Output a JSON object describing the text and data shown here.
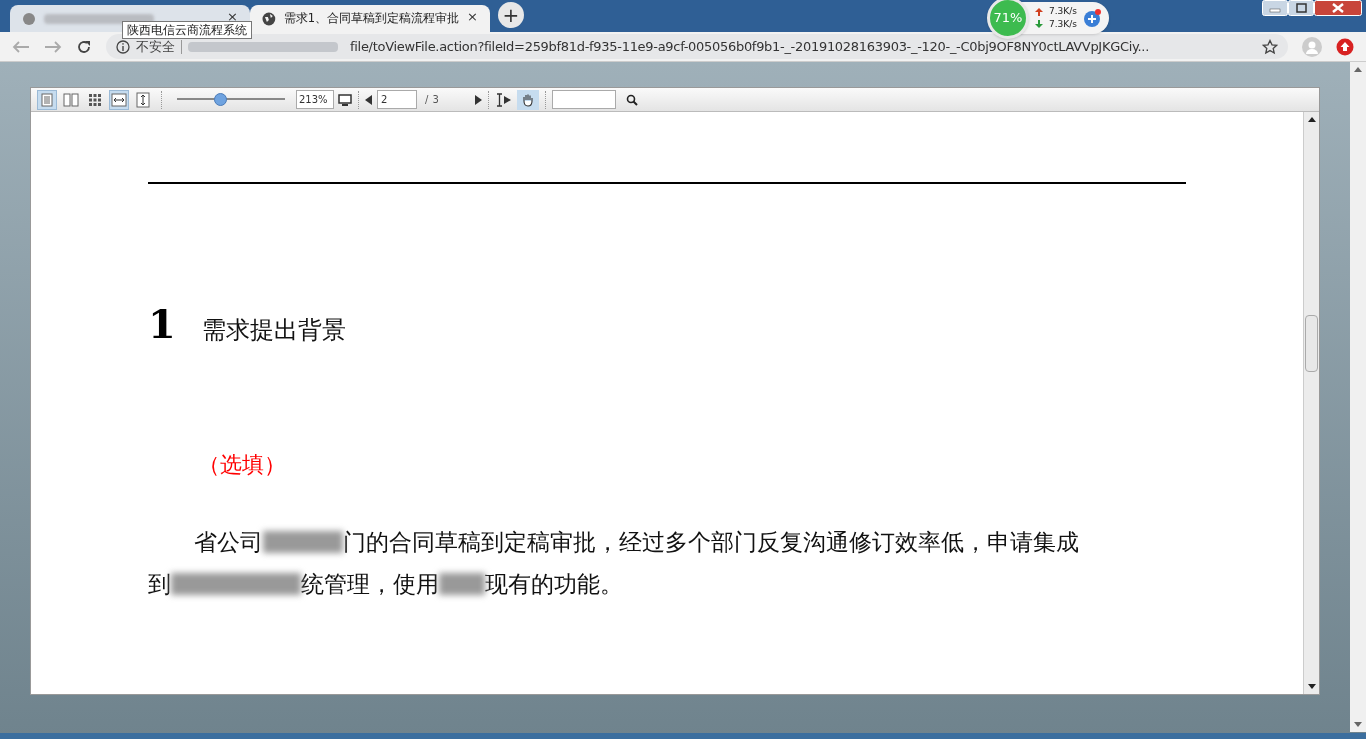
{
  "tabs": [
    {
      "kind": "redacted",
      "selected": false,
      "close": "×"
    },
    {
      "kind": "titled",
      "title": "需求1、合同草稿到定稿流程审批",
      "selected": true,
      "close": "×"
    }
  ],
  "new_tab": "+",
  "tooltip": "陕西电信云商流程系统",
  "address": {
    "security": "不安全",
    "url": "file/toViewFile.action?fileId=259bf81d-f935-11e9-a9cf-005056b0f9b1-_-20191028163903-_-120-_-C0bj9OF8NY0ctLAVVpJKGCiy..."
  },
  "speed_widget": {
    "percent": "71%",
    "up": "7.3K/s",
    "down": "7.3K/s"
  },
  "viewer": {
    "zoom": {
      "level": 0.4,
      "value": "213%"
    },
    "page": "2",
    "page_sep": "/",
    "page_total": "3",
    "tools": [
      {
        "kind": "single",
        "selected": true
      },
      {
        "kind": "double",
        "selected": false
      },
      {
        "kind": "grid",
        "selected": false
      },
      {
        "kind": "fitwidth",
        "selected": true
      },
      {
        "kind": "fitheight",
        "selected": false
      }
    ],
    "hand_selected": true
  },
  "document": {
    "heading_number": "1",
    "heading": "需求提出背景",
    "note": "（选填）",
    "paragraph": [
      [
        {
          "kind": "text",
          "text": "省公司"
        },
        {
          "kind": "redacted"
        },
        {
          "kind": "text",
          "text": "门的合同草稿到定稿审批，经过多个部门反复沟通修订效率低，申请集成"
        }
      ],
      [
        {
          "kind": "text",
          "text": "到"
        },
        {
          "kind": "redacted"
        },
        {
          "kind": "text",
          "text": "统管理，使用"
        },
        {
          "kind": "redacted"
        },
        {
          "kind": "text",
          "text": "现有的功能。"
        }
      ]
    ]
  }
}
